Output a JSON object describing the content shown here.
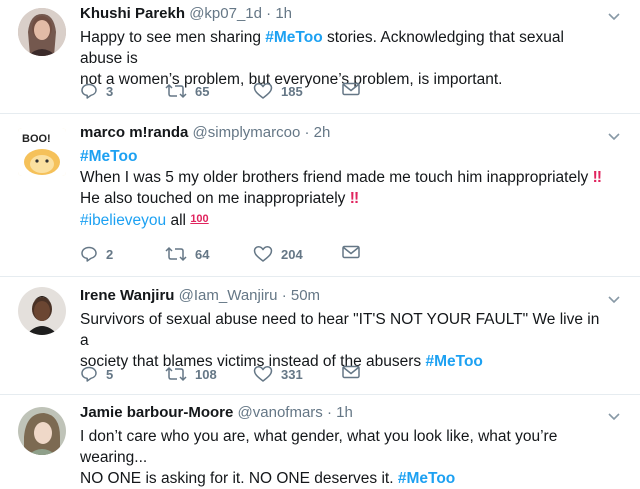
{
  "tweets": [
    {
      "name": "Khushi Parekh",
      "handle": "@kp07_1d",
      "time": "1h",
      "lines": [
        [
          {
            "t": "Happy to see men sharing "
          },
          {
            "tag": "#MeToo"
          },
          {
            "t": " stories. Acknowledging that sexual abuse is"
          }
        ],
        [
          {
            "t": "not a women’s problem, but everyone’s problem, is important."
          }
        ]
      ],
      "replies": "3",
      "retweets": "65",
      "likes": "185"
    },
    {
      "name": "marco m!randa",
      "handle": "@simplymarcoo",
      "time": "2h",
      "avatar_text": "BOO!",
      "lines": [
        [
          {
            "tag": "#MeToo"
          }
        ],
        [
          {
            "t": "When I was 5 my older brothers friend made me touch him inappropriately "
          },
          {
            "e": "‼"
          }
        ],
        [
          {
            "t": "He also touched on me inappropriately "
          },
          {
            "e": "‼"
          }
        ],
        [
          {
            "tagthin": "#ibelieveyou"
          },
          {
            "t": " all "
          },
          {
            "e100": "100"
          }
        ]
      ],
      "replies": "2",
      "retweets": "64",
      "likes": "204"
    },
    {
      "name": "Irene Wanjiru",
      "handle": "@Iam_Wanjiru",
      "time": "50m",
      "lines": [
        [
          {
            "t": "Survivors of sexual abuse need to hear \"IT'S NOT YOUR FAULT\" We live in a"
          }
        ],
        [
          {
            "t": "society that blames victims instead of the abusers "
          },
          {
            "tag": "#MeToo"
          }
        ]
      ],
      "replies": "5",
      "retweets": "108",
      "likes": "331"
    },
    {
      "name": "Jamie barbour-Moore",
      "handle": "@vanofmars",
      "time": "1h",
      "lines": [
        [
          {
            "t": "I don’t care who you are, what gender, what you look like, what you’re wearing..."
          }
        ],
        [
          {
            "t": "NO ONE is asking for it. NO ONE deserves it. "
          },
          {
            "tag": "#MeToo"
          }
        ]
      ],
      "replies": "",
      "retweets": "",
      "likes": ""
    }
  ],
  "icons": {
    "reply": "reply-icon",
    "retweet": "retweet-icon",
    "like": "heart-icon",
    "message": "envelope-icon",
    "caret": "chevron-down-icon"
  },
  "colors": {
    "hashtag": "#1da1f2",
    "secondary": "#657786",
    "emoji_red": "#e0245e"
  }
}
